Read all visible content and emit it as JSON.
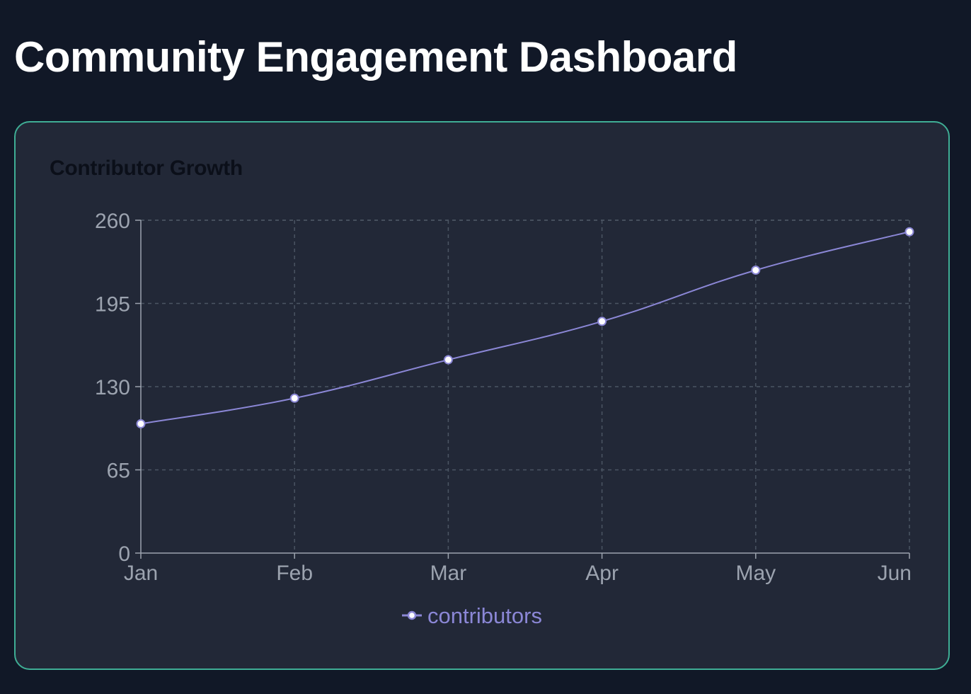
{
  "page": {
    "title": "Community Engagement Dashboard"
  },
  "card": {
    "title": "Contributor Growth"
  },
  "chart_data": {
    "type": "line",
    "title": "Contributor Growth",
    "categories": [
      "Jan",
      "Feb",
      "Mar",
      "Apr",
      "May",
      "Jun"
    ],
    "series": [
      {
        "name": "contributors",
        "values": [
          101,
          121,
          151,
          181,
          221,
          251
        ],
        "color": "#8b87d6"
      }
    ],
    "y_ticks": [
      0,
      65,
      130,
      195,
      260
    ],
    "ylim": [
      0,
      260
    ],
    "grid": true,
    "legend_position": "bottom-center",
    "xlabel": "",
    "ylabel": ""
  },
  "colors": {
    "background": "#111827",
    "card": "#222837",
    "card_border": "#3fae95",
    "line": "#8b87d6",
    "grid": "#4b5563",
    "axis": "#9ca3af"
  }
}
